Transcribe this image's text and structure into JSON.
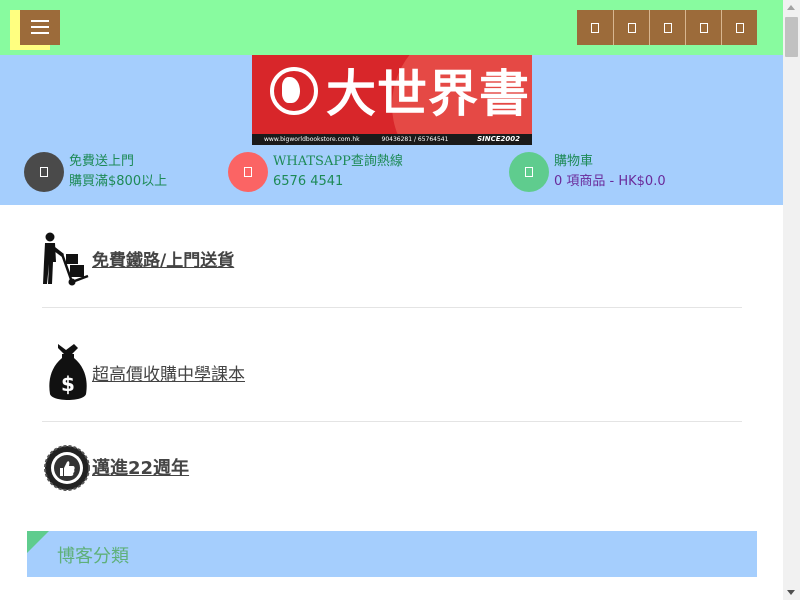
{
  "topbar": {
    "menu_icon": "hamburger-icon",
    "social_icons": [
      "facebook-icon",
      "twitter-icon",
      "instagram-icon",
      "youtube-icon",
      "email-icon"
    ]
  },
  "header": {
    "logo": {
      "title": "大世界書店",
      "url_text": "www.bigworldbookstore.com.hk",
      "phone_text": "90436281 / 65764541",
      "since": "SINCE2002"
    },
    "info": [
      {
        "icon": "truck-icon",
        "title": "免費送上門",
        "subtitle": "購買滿$800以上"
      },
      {
        "icon": "whatsapp-icon",
        "title": "WHATSAPP查詢熱線",
        "subtitle": "6576 4541"
      },
      {
        "icon": "cart-icon",
        "title": "購物車",
        "subtitle": "0 項商品 - HK$0.0"
      }
    ]
  },
  "features": [
    {
      "icon": "delivery-worker-icon",
      "label": "免費鐵路/上門送貨"
    },
    {
      "icon": "money-bag-icon",
      "label": "超高價收購中學課本"
    },
    {
      "icon": "best-choice-badge-icon",
      "label": "邁進22週年"
    }
  ],
  "blog": {
    "title": "博客分類"
  },
  "colors": {
    "topbar_bg": "#88fb9f",
    "header_bg": "#a5cefd",
    "button_brown": "#9c6b3a",
    "logo_red": "#d8262a"
  }
}
